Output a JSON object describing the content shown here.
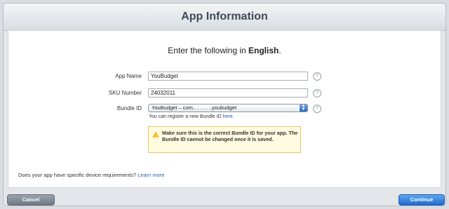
{
  "header": {
    "title": "App Information"
  },
  "form": {
    "heading_prefix": "Enter the following in ",
    "heading_language": "English",
    "heading_suffix": ".",
    "app_name_label": "App Name",
    "app_name_value": "YouBudget",
    "sku_label": "SKU Number",
    "sku_value": "24032011",
    "bundle_label": "Bundle ID",
    "bundle_value": "YouBudget – com.. . . . . ..youbudget",
    "register_prefix": "You can register a new Bundle ID ",
    "register_link": "here",
    "register_suffix": ".",
    "help_glyph": "?",
    "help_icon": "question-mark-circle-icon",
    "warning_icon": "warning-triangle-icon",
    "warning_text": "Make sure this is the correct Bundle ID for your app. The Bundle ID cannot be changed once it is saved.",
    "device_question": "Does your app have specific device requirements? ",
    "device_link": "Learn more"
  },
  "footer": {
    "cancel_label": "Cancel",
    "continue_label": "Continue"
  },
  "colors": {
    "link": "#2a5db0",
    "continue_button": "#1f6bd0",
    "warning_background": "#fffbe0"
  }
}
